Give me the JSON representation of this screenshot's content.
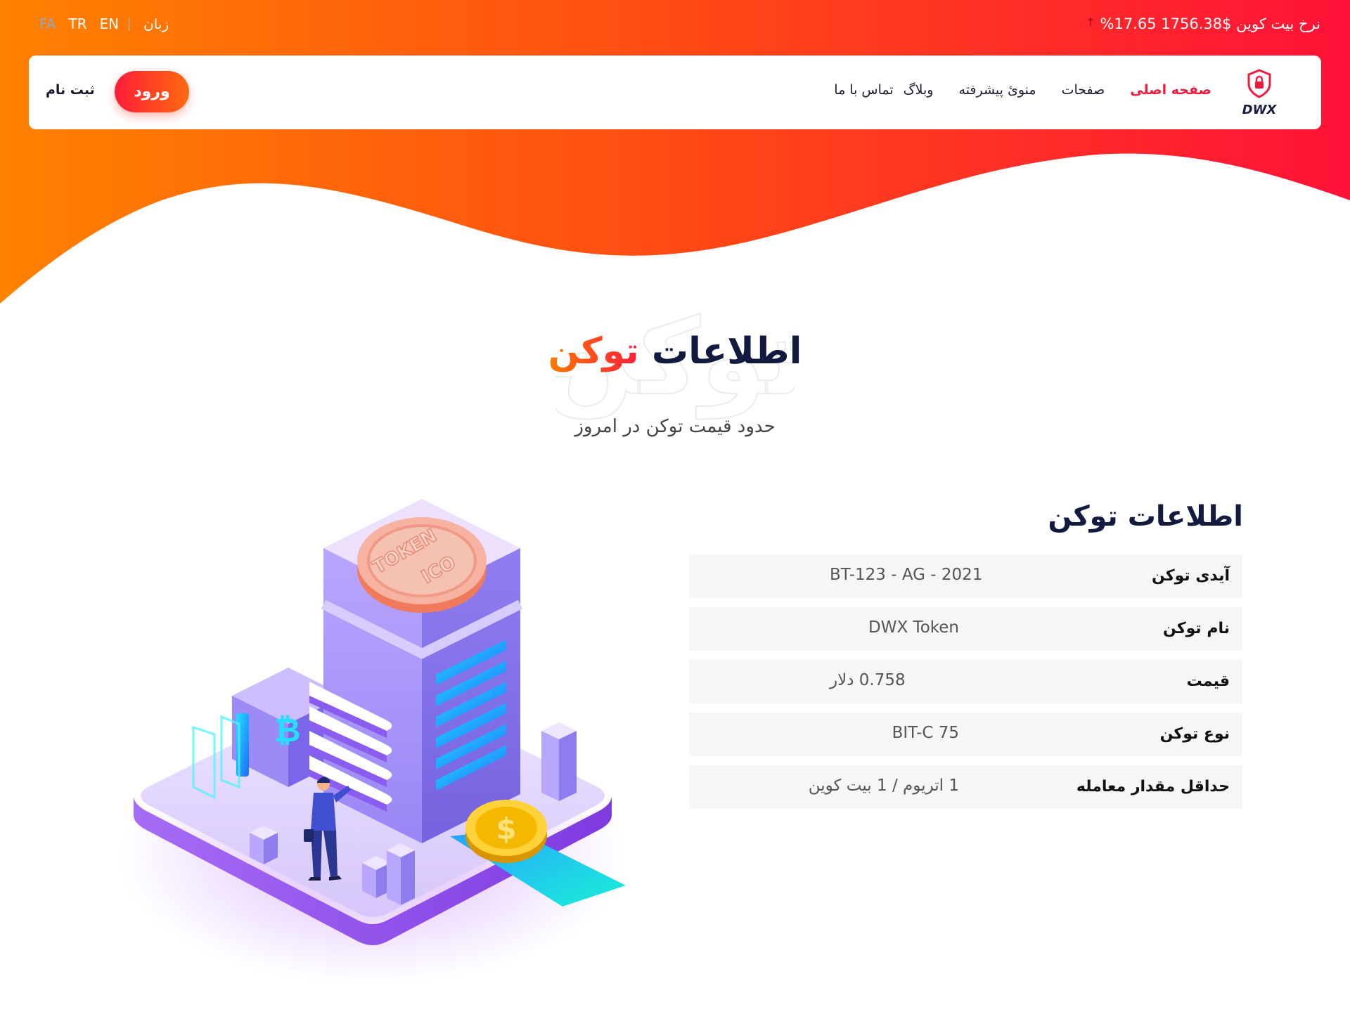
{
  "topbar": {
    "ticker_label": "نرخ بیت کوین",
    "ticker_value": "$1756.38",
    "ticker_change": "17.65%",
    "language_label": "زبان",
    "languages": [
      "EN",
      "TR",
      "FA"
    ]
  },
  "nav": {
    "logo_text": "DWX",
    "items": [
      {
        "label": "صفحه اصلی"
      },
      {
        "label": "صفحات"
      },
      {
        "label": "منوئ پیشرفته"
      },
      {
        "label": "وبلاگ"
      },
      {
        "label": "تماس با ما"
      }
    ],
    "login_label": "ورود",
    "register_label": "ثبت نام"
  },
  "section": {
    "title_main": "اطلاعات",
    "title_accent": "توکن",
    "watermark": "توکن",
    "subtitle": "حدود قیمت توکن در امروز"
  },
  "token_info": {
    "title": "اطلاعات توکن",
    "rows": [
      {
        "key": "آیدی توکن",
        "value": "BT-123 - AG - 2021"
      },
      {
        "key": "نام توکن",
        "value": "DWX Token"
      },
      {
        "key": "قیمت",
        "value": "0.758 دلار"
      },
      {
        "key": "نوع توکن",
        "value": "BIT-C 75"
      },
      {
        "key": "حداقل مقدار معامله",
        "value": "1 اتریوم / 1 بیت کوین"
      }
    ]
  },
  "illustration": {
    "coin_text_1": "TOKEN",
    "coin_text_2": "ICO",
    "dollar_symbol": "$",
    "bitcoin_symbol": "₿"
  },
  "colors": {
    "gradient_start": "#ff8200",
    "gradient_end": "#ff1238",
    "accent_red": "#ee1c3c",
    "navy": "#131a40"
  }
}
